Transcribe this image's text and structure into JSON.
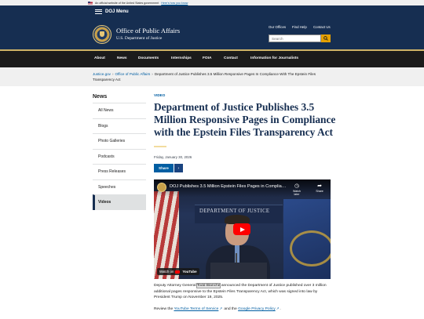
{
  "gov_banner": {
    "text": "An official website of the United States government",
    "link": "Here's how you know"
  },
  "doj_menu": {
    "label": "DOJ Menu"
  },
  "header": {
    "title": "Office of Public Affairs",
    "subtitle": "U.S. Department of Justice",
    "utility_links": [
      "Our Offices",
      "Find Help",
      "Contact Us"
    ],
    "search_placeholder": "Search"
  },
  "nav": {
    "items": [
      "About",
      "News",
      "Documents",
      "Internships",
      "FOIA",
      "Contact",
      "Information for Journalists"
    ]
  },
  "breadcrumb": {
    "items": [
      "Justice.gov",
      "Office of Public Affairs"
    ],
    "current": "Department of Justice Publishes 3.5 Million Responsive Pages In Compliance With The Epstein Files Transparency Act"
  },
  "sidebar": {
    "title": "News",
    "items": [
      "All News",
      "Blogs",
      "Photo Galleries",
      "Podcasts",
      "Press Releases",
      "Speeches",
      "Videos"
    ],
    "active": "Videos"
  },
  "article": {
    "tag": "VIDEO",
    "title": "Department of Justice Publishes 3.5 Million Responsive Pages in Compliance with the Epstein Files Transparency Act",
    "date": "Friday, January 30, 2026",
    "share_label": "Share",
    "share_icon": "chevron-right-icon",
    "para_before": "Deputy Attorney General ",
    "para_highlight": "Todd Blanche",
    "para_after": " announced the Department of Justice published over 3 million additional pages responsive to the Epstein Files Transparency Act, which was signed into law by President Trump on November 19, 2025.",
    "review_prefix": "Review the ",
    "tos_link": "YouTube Terms of Service",
    "review_mid": " and the ",
    "privacy_link": "Google Privacy Policy",
    "review_suffix": "."
  },
  "video": {
    "title": "DOJ Publishes 3.5 Million Epstein Files Pages in Complianc...",
    "watch_later": "Watch later",
    "share": "Share",
    "sign_text": "DEPARTMENT OF JUSTICE",
    "watch_on": "Watch on",
    "youtube": "YouTube",
    "colors": {
      "play": "#ff0000"
    }
  },
  "colors": {
    "header_bg": "#162e51",
    "nav_bg": "#1b1b1b",
    "accent_gold": "#e5a000",
    "link_blue": "#005ea2"
  }
}
